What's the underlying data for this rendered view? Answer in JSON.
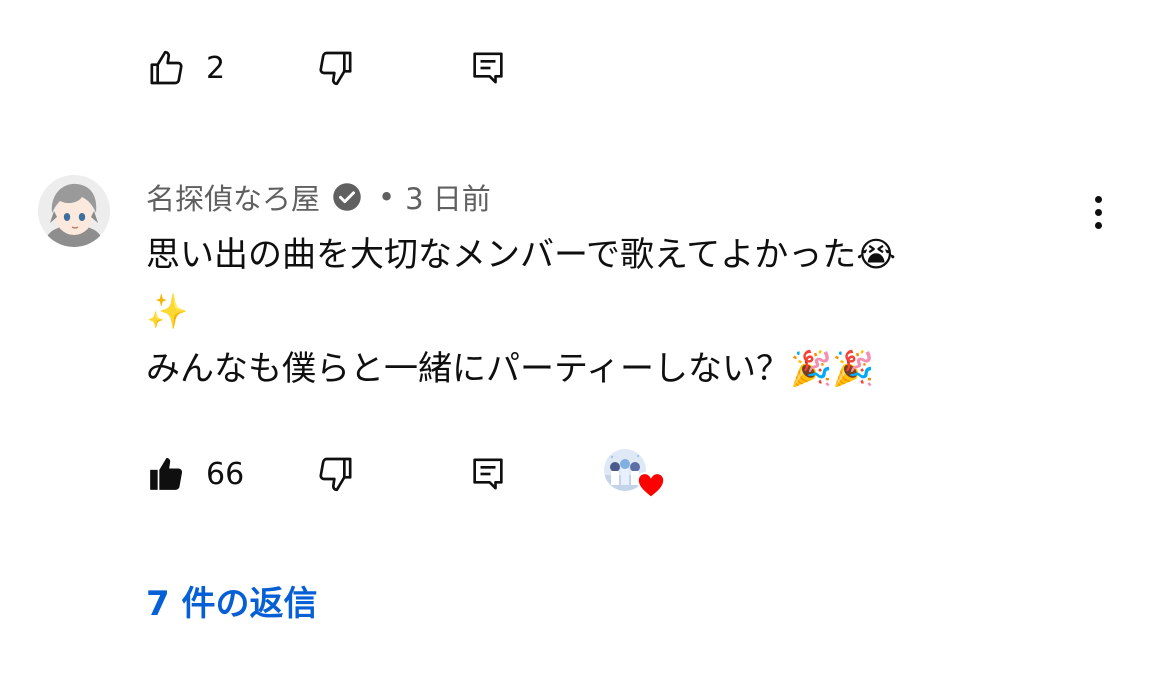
{
  "previous_comment": {
    "like_count": "2"
  },
  "comment": {
    "author": "名探偵なろ屋",
    "separator": "•",
    "time": "3 日前",
    "text_lines": [
      "思い出の曲を大切なメンバーで歌えてよかった😭",
      "✨",
      "みんなも僕らと一緒にパーティーしない？🎉🎉"
    ],
    "like_count": "66",
    "replies_label": "7 件の返信"
  },
  "colors": {
    "link_blue": "#065fd4",
    "meta_gray": "#606060",
    "heart_red": "#ff0000"
  },
  "icons": {
    "like": "thumb-up-outline",
    "liked": "thumb-up-filled",
    "dislike": "thumb-down-outline",
    "reply": "comment-icon",
    "verified": "verified-check",
    "more": "three-dot-vertical",
    "creator_heart": "heart"
  }
}
